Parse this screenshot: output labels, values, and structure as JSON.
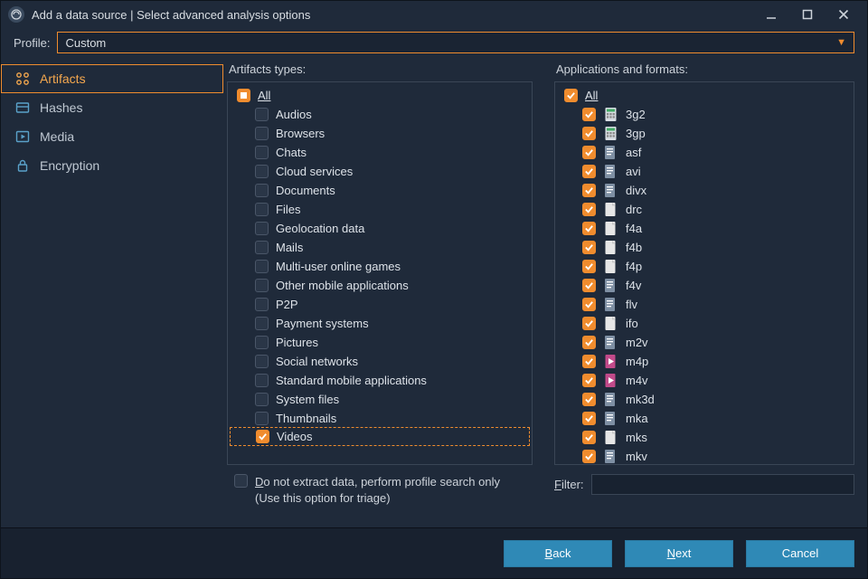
{
  "title": "Add a data source | Select advanced analysis options",
  "profile": {
    "label": "Profile:",
    "value": "Custom"
  },
  "sidebar": [
    {
      "label": "Artifacts",
      "icon": "grid"
    },
    {
      "label": "Hashes",
      "icon": "hash"
    },
    {
      "label": "Media",
      "icon": "media"
    },
    {
      "label": "Encryption",
      "icon": "lock"
    }
  ],
  "artifacts": {
    "title": "Artifacts types:",
    "all_label": "All",
    "items": [
      "Audios",
      "Browsers",
      "Chats",
      "Cloud services",
      "Documents",
      "Files",
      "Geolocation data",
      "Mails",
      "Multi-user online games",
      "Other mobile applications",
      "P2P",
      "Payment systems",
      "Pictures",
      "Social networks",
      "Standard mobile applications",
      "System files",
      "Thumbnails",
      "Videos"
    ],
    "checked": [
      "Videos"
    ]
  },
  "apps": {
    "title": "Applications and formats:",
    "all_label": "All",
    "items": [
      {
        "n": "3g2",
        "i": "calc"
      },
      {
        "n": "3gp",
        "i": "calc"
      },
      {
        "n": "asf",
        "i": "doc"
      },
      {
        "n": "avi",
        "i": "doc"
      },
      {
        "n": "divx",
        "i": "doc"
      },
      {
        "n": "drc",
        "i": "page"
      },
      {
        "n": "f4a",
        "i": "page"
      },
      {
        "n": "f4b",
        "i": "page"
      },
      {
        "n": "f4p",
        "i": "page"
      },
      {
        "n": "f4v",
        "i": "doc"
      },
      {
        "n": "flv",
        "i": "doc"
      },
      {
        "n": "ifo",
        "i": "page"
      },
      {
        "n": "m2v",
        "i": "doc"
      },
      {
        "n": "m4p",
        "i": "media"
      },
      {
        "n": "m4v",
        "i": "media"
      },
      {
        "n": "mk3d",
        "i": "doc"
      },
      {
        "n": "mka",
        "i": "doc"
      },
      {
        "n": "mks",
        "i": "page"
      },
      {
        "n": "mkv",
        "i": "doc"
      }
    ]
  },
  "triage": {
    "line1a": "D",
    "line1b": "o not extract data, perform profile search only",
    "line2": "(Use this option for triage)"
  },
  "filter_label_a": "F",
  "filter_label_b": "ilter:",
  "buttons": {
    "back_a": "B",
    "back_b": "ack",
    "next_a": "N",
    "next_b": "ext",
    "cancel": "Cancel"
  }
}
